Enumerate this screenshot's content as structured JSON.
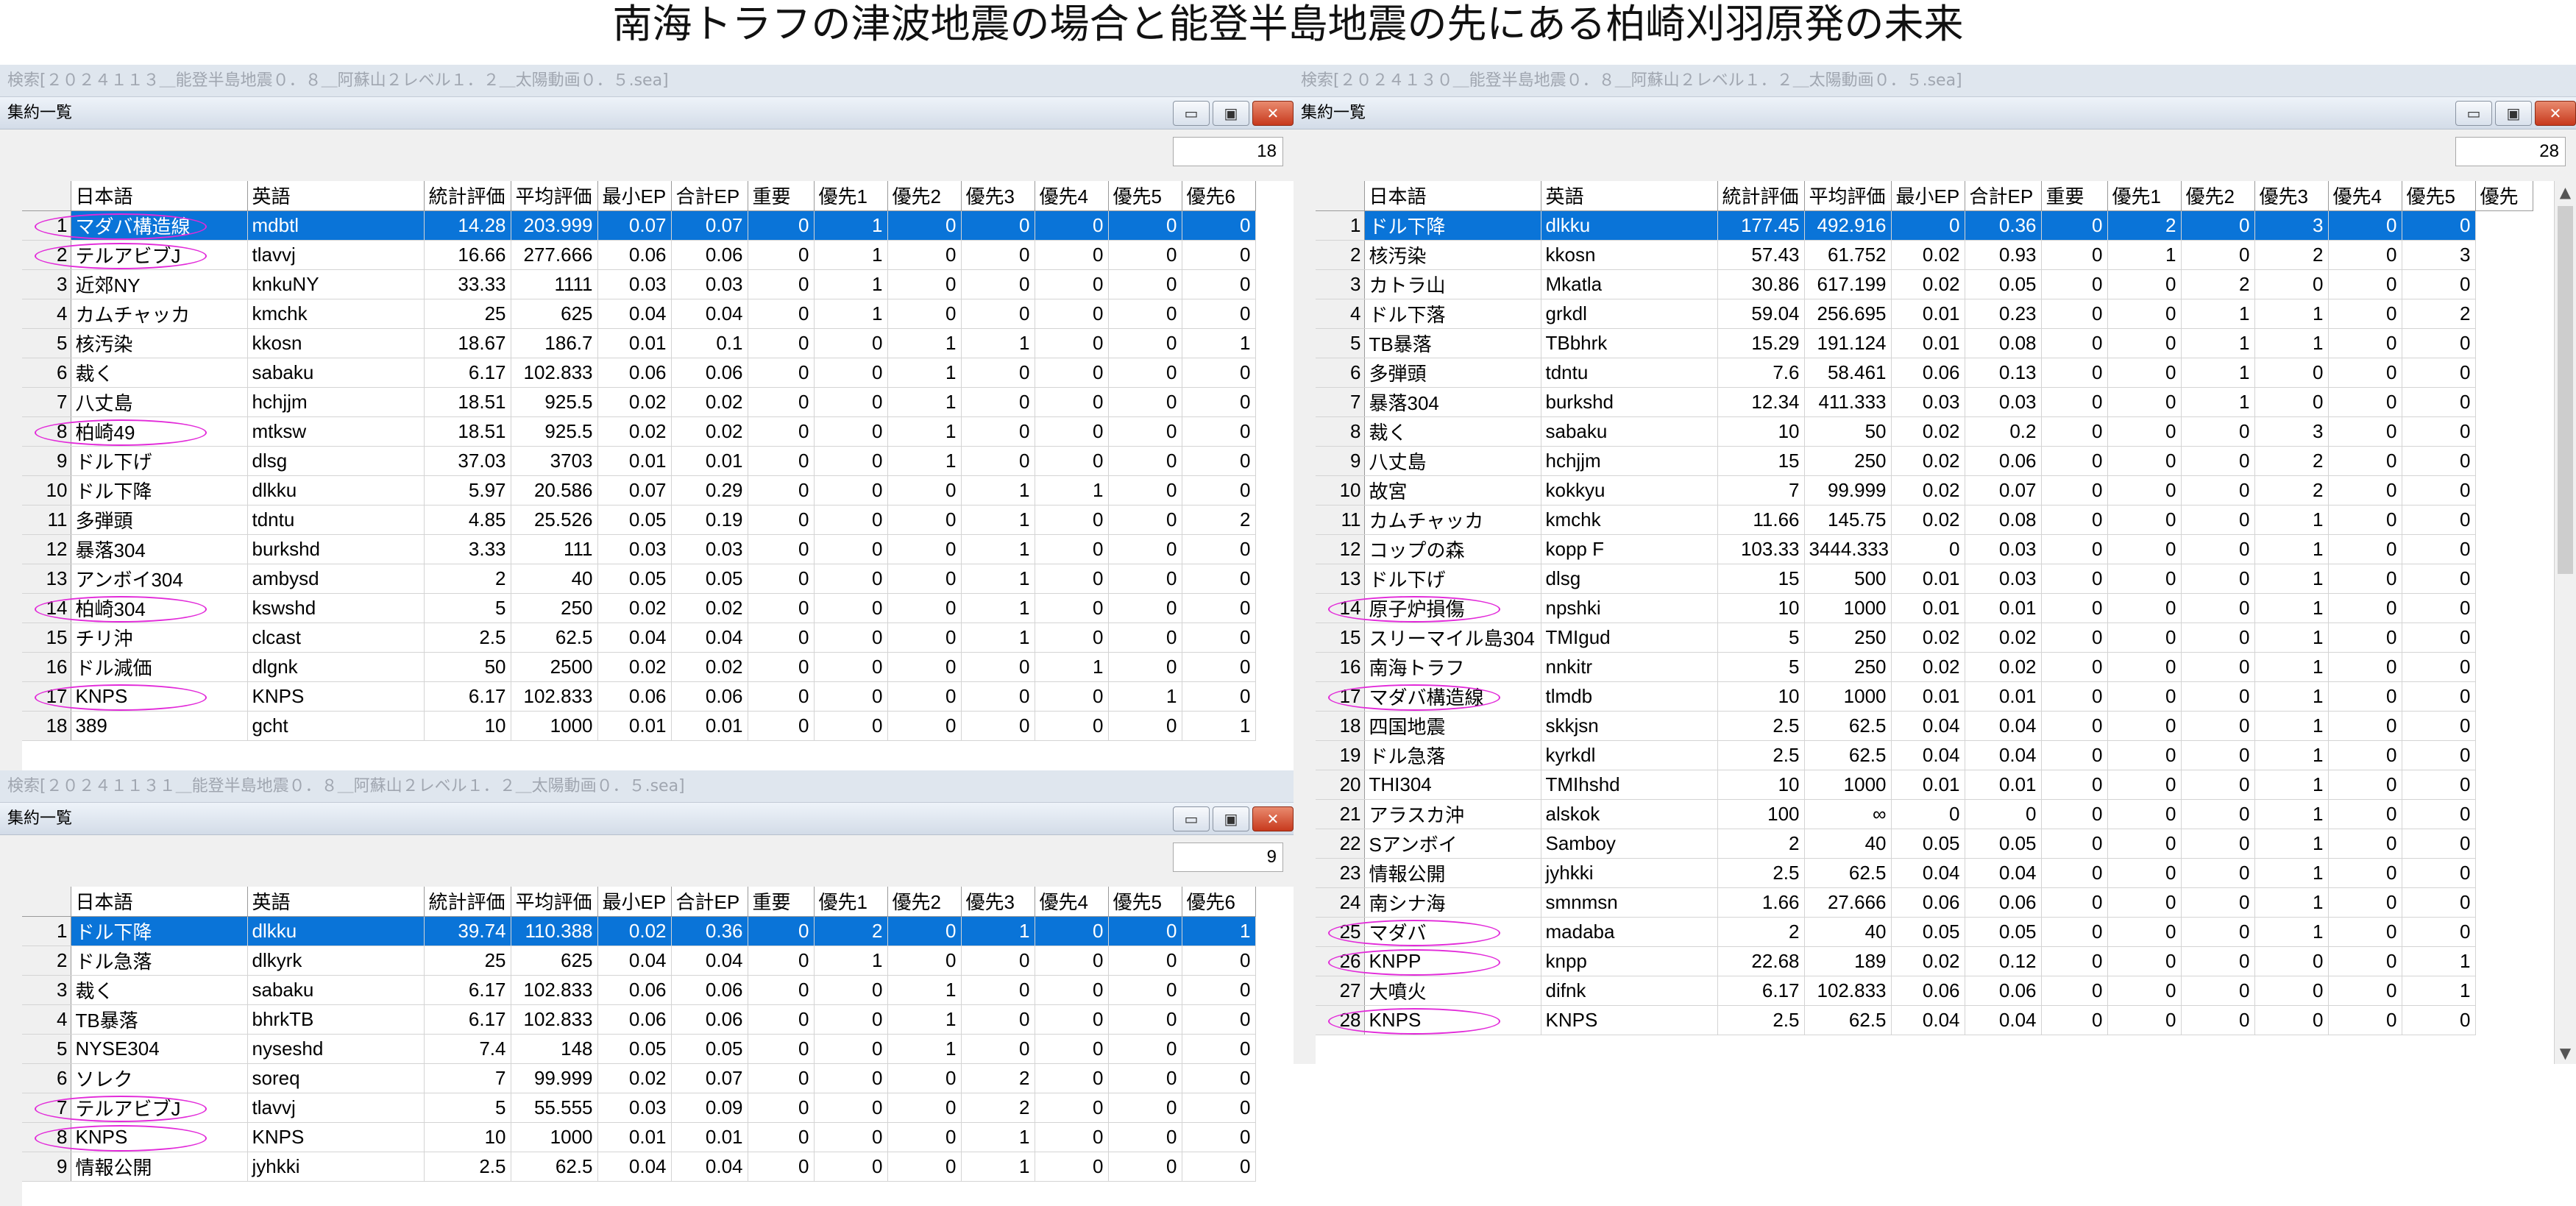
{
  "page": {
    "title": "南海トラフの津波地震の場合と能登半島地震の先にある柏崎刈羽原発の未来"
  },
  "colors": {
    "selected_row": "#0a74d8",
    "highlight_ellipse": "#e22ad9",
    "close_button": "#c7391d"
  },
  "columns": [
    "日本語",
    "英語",
    "統計評価",
    "平均評価",
    "最小EP",
    "合計EP",
    "重要",
    "優先1",
    "優先2",
    "優先3",
    "優先4",
    "優先5",
    "優先6"
  ],
  "columns_p3": [
    "日本語",
    "英語",
    "統計評価",
    "平均評価",
    "最小EP",
    "合計EP",
    "重要",
    "優先1",
    "優先2",
    "優先3",
    "優先4",
    "優先5",
    "優先"
  ],
  "panels": [
    {
      "search": "検索[２０２４１１３＿能登半島地震０．８＿阿蘇山２レベル１．２＿太陽動画０．５.sea]",
      "window_title": "集約一覧",
      "count": "18",
      "selected": 0,
      "highlighted": [
        0,
        1,
        7,
        13,
        16
      ],
      "rows": [
        [
          "1",
          "マダバ構造線",
          "mdbtl",
          "14.28",
          "203.999",
          "0.07",
          "0.07",
          "0",
          "1",
          "0",
          "0",
          "0",
          "0",
          "0"
        ],
        [
          "2",
          "テルアビブJ",
          "tlavvj",
          "16.66",
          "277.666",
          "0.06",
          "0.06",
          "0",
          "1",
          "0",
          "0",
          "0",
          "0",
          "0"
        ],
        [
          "3",
          "近郊NY",
          "knkuNY",
          "33.33",
          "1111",
          "0.03",
          "0.03",
          "0",
          "1",
          "0",
          "0",
          "0",
          "0",
          "0"
        ],
        [
          "4",
          "カムチャッカ",
          "kmchk",
          "25",
          "625",
          "0.04",
          "0.04",
          "0",
          "1",
          "0",
          "0",
          "0",
          "0",
          "0"
        ],
        [
          "5",
          "核汚染",
          "kkosn",
          "18.67",
          "186.7",
          "0.01",
          "0.1",
          "0",
          "0",
          "1",
          "1",
          "0",
          "0",
          "1"
        ],
        [
          "6",
          "裁く",
          "sabaku",
          "6.17",
          "102.833",
          "0.06",
          "0.06",
          "0",
          "0",
          "1",
          "0",
          "0",
          "0",
          "0"
        ],
        [
          "7",
          "八丈島",
          "hchjjm",
          "18.51",
          "925.5",
          "0.02",
          "0.02",
          "0",
          "0",
          "1",
          "0",
          "0",
          "0",
          "0"
        ],
        [
          "8",
          "柏崎49",
          "mtksw",
          "18.51",
          "925.5",
          "0.02",
          "0.02",
          "0",
          "0",
          "1",
          "0",
          "0",
          "0",
          "0"
        ],
        [
          "9",
          "ドル下げ",
          "dlsg",
          "37.03",
          "3703",
          "0.01",
          "0.01",
          "0",
          "0",
          "1",
          "0",
          "0",
          "0",
          "0"
        ],
        [
          "10",
          "ドル下降",
          "dlkku",
          "5.97",
          "20.586",
          "0.07",
          "0.29",
          "0",
          "0",
          "0",
          "1",
          "1",
          "0",
          "0"
        ],
        [
          "11",
          "多弾頭",
          "tdntu",
          "4.85",
          "25.526",
          "0.05",
          "0.19",
          "0",
          "0",
          "0",
          "1",
          "0",
          "0",
          "2"
        ],
        [
          "12",
          "暴落304",
          "burkshd",
          "3.33",
          "111",
          "0.03",
          "0.03",
          "0",
          "0",
          "0",
          "1",
          "0",
          "0",
          "0"
        ],
        [
          "13",
          "アンボイ304",
          "ambysd",
          "2",
          "40",
          "0.05",
          "0.05",
          "0",
          "0",
          "0",
          "1",
          "0",
          "0",
          "0"
        ],
        [
          "14",
          "柏崎304",
          "kswshd",
          "5",
          "250",
          "0.02",
          "0.02",
          "0",
          "0",
          "0",
          "1",
          "0",
          "0",
          "0"
        ],
        [
          "15",
          "チリ沖",
          "clcast",
          "2.5",
          "62.5",
          "0.04",
          "0.04",
          "0",
          "0",
          "0",
          "1",
          "0",
          "0",
          "0"
        ],
        [
          "16",
          "ドル減価",
          "dlgnk",
          "50",
          "2500",
          "0.02",
          "0.02",
          "0",
          "0",
          "0",
          "0",
          "1",
          "0",
          "0"
        ],
        [
          "17",
          "KNPS",
          "KNPS",
          "6.17",
          "102.833",
          "0.06",
          "0.06",
          "0",
          "0",
          "0",
          "0",
          "0",
          "1",
          "0"
        ],
        [
          "18",
          "389",
          "gcht",
          "10",
          "1000",
          "0.01",
          "0.01",
          "0",
          "0",
          "0",
          "0",
          "0",
          "0",
          "1"
        ]
      ]
    },
    {
      "search": "検索[２０２４１１３１＿能登半島地震０．８＿阿蘇山２レベル１．２＿太陽動画０．５.sea]",
      "window_title": "集約一覧",
      "count": "9",
      "selected": 0,
      "highlighted": [
        6,
        7
      ],
      "rows": [
        [
          "1",
          "ドル下降",
          "dlkku",
          "39.74",
          "110.388",
          "0.02",
          "0.36",
          "0",
          "2",
          "0",
          "1",
          "0",
          "0",
          "1"
        ],
        [
          "2",
          "ドル急落",
          "dlkyrk",
          "25",
          "625",
          "0.04",
          "0.04",
          "0",
          "1",
          "0",
          "0",
          "0",
          "0",
          "0"
        ],
        [
          "3",
          "裁く",
          "sabaku",
          "6.17",
          "102.833",
          "0.06",
          "0.06",
          "0",
          "0",
          "1",
          "0",
          "0",
          "0",
          "0"
        ],
        [
          "4",
          "TB暴落",
          "bhrkTB",
          "6.17",
          "102.833",
          "0.06",
          "0.06",
          "0",
          "0",
          "1",
          "0",
          "0",
          "0",
          "0"
        ],
        [
          "5",
          "NYSE304",
          "nyseshd",
          "7.4",
          "148",
          "0.05",
          "0.05",
          "0",
          "0",
          "1",
          "0",
          "0",
          "0",
          "0"
        ],
        [
          "6",
          "ソレク",
          "soreq",
          "7",
          "99.999",
          "0.02",
          "0.07",
          "0",
          "0",
          "0",
          "2",
          "0",
          "0",
          "0"
        ],
        [
          "7",
          "テルアビブJ",
          "tlavvj",
          "5",
          "55.555",
          "0.03",
          "0.09",
          "0",
          "0",
          "0",
          "2",
          "0",
          "0",
          "0"
        ],
        [
          "8",
          "KNPS",
          "KNPS",
          "10",
          "1000",
          "0.01",
          "0.01",
          "0",
          "0",
          "0",
          "1",
          "0",
          "0",
          "0"
        ],
        [
          "9",
          "情報公開",
          "jyhkki",
          "2.5",
          "62.5",
          "0.04",
          "0.04",
          "0",
          "0",
          "0",
          "1",
          "0",
          "0",
          "0"
        ]
      ]
    },
    {
      "search": "検索[２０２４１３０＿能登半島地震０．８＿阿蘇山２レベル１．２＿太陽動画０．５.sea]",
      "window_title": "集約一覧",
      "count": "28",
      "selected": 0,
      "highlighted": [
        13,
        16,
        24,
        25,
        27
      ],
      "rows": [
        [
          "1",
          "ドル下降",
          "dlkku",
          "177.45",
          "492.916",
          "0",
          "0.36",
          "0",
          "2",
          "0",
          "3",
          "0",
          "0"
        ],
        [
          "2",
          "核汚染",
          "kkosn",
          "57.43",
          "61.752",
          "0.02",
          "0.93",
          "0",
          "1",
          "0",
          "2",
          "0",
          "3"
        ],
        [
          "3",
          "カトラ山",
          "Mkatla",
          "30.86",
          "617.199",
          "0.02",
          "0.05",
          "0",
          "0",
          "2",
          "0",
          "0",
          "0"
        ],
        [
          "4",
          "ドル下落",
          "grkdl",
          "59.04",
          "256.695",
          "0.01",
          "0.23",
          "0",
          "0",
          "1",
          "1",
          "0",
          "2"
        ],
        [
          "5",
          "TB暴落",
          "TBbhrk",
          "15.29",
          "191.124",
          "0.01",
          "0.08",
          "0",
          "0",
          "1",
          "1",
          "0",
          "0"
        ],
        [
          "6",
          "多弾頭",
          "tdntu",
          "7.6",
          "58.461",
          "0.06",
          "0.13",
          "0",
          "0",
          "1",
          "0",
          "0",
          "0"
        ],
        [
          "7",
          "暴落304",
          "burkshd",
          "12.34",
          "411.333",
          "0.03",
          "0.03",
          "0",
          "0",
          "1",
          "0",
          "0",
          "0"
        ],
        [
          "8",
          "裁く",
          "sabaku",
          "10",
          "50",
          "0.02",
          "0.2",
          "0",
          "0",
          "0",
          "3",
          "0",
          "0"
        ],
        [
          "9",
          "八丈島",
          "hchjjm",
          "15",
          "250",
          "0.02",
          "0.06",
          "0",
          "0",
          "0",
          "2",
          "0",
          "0"
        ],
        [
          "10",
          "故宮",
          "kokkyu",
          "7",
          "99.999",
          "0.02",
          "0.07",
          "0",
          "0",
          "0",
          "2",
          "0",
          "0"
        ],
        [
          "11",
          "カムチャッカ",
          "kmchk",
          "11.66",
          "145.75",
          "0.02",
          "0.08",
          "0",
          "0",
          "0",
          "1",
          "0",
          "0"
        ],
        [
          "12",
          "コップの森",
          "kopp F",
          "103.33",
          "3444.333",
          "0",
          "0.03",
          "0",
          "0",
          "0",
          "1",
          "0",
          "0"
        ],
        [
          "13",
          "ドル下げ",
          "dlsg",
          "15",
          "500",
          "0.01",
          "0.03",
          "0",
          "0",
          "0",
          "1",
          "0",
          "0"
        ],
        [
          "14",
          "原子炉損傷",
          "npshki",
          "10",
          "1000",
          "0.01",
          "0.01",
          "0",
          "0",
          "0",
          "1",
          "0",
          "0"
        ],
        [
          "15",
          "スリーマイル島304",
          "TMIgud",
          "5",
          "250",
          "0.02",
          "0.02",
          "0",
          "0",
          "0",
          "1",
          "0",
          "0"
        ],
        [
          "16",
          "南海トラフ",
          "nnkitr",
          "5",
          "250",
          "0.02",
          "0.02",
          "0",
          "0",
          "0",
          "1",
          "0",
          "0"
        ],
        [
          "17",
          "マダバ構造線",
          "tlmdb",
          "10",
          "1000",
          "0.01",
          "0.01",
          "0",
          "0",
          "0",
          "1",
          "0",
          "0"
        ],
        [
          "18",
          "四国地震",
          "skkjsn",
          "2.5",
          "62.5",
          "0.04",
          "0.04",
          "0",
          "0",
          "0",
          "1",
          "0",
          "0"
        ],
        [
          "19",
          "ドル急落",
          "kyrkdl",
          "2.5",
          "62.5",
          "0.04",
          "0.04",
          "0",
          "0",
          "0",
          "1",
          "0",
          "0"
        ],
        [
          "20",
          "THI304",
          "TMIhshd",
          "10",
          "1000",
          "0.01",
          "0.01",
          "0",
          "0",
          "0",
          "1",
          "0",
          "0"
        ],
        [
          "21",
          "アラスカ沖",
          "alskok",
          "100",
          "∞",
          "0",
          "0",
          "0",
          "0",
          "0",
          "1",
          "0",
          "0"
        ],
        [
          "22",
          "Sアンボイ",
          "Samboy",
          "2",
          "40",
          "0.05",
          "0.05",
          "0",
          "0",
          "0",
          "1",
          "0",
          "0"
        ],
        [
          "23",
          "情報公開",
          "jyhkki",
          "2.5",
          "62.5",
          "0.04",
          "0.04",
          "0",
          "0",
          "0",
          "1",
          "0",
          "0"
        ],
        [
          "24",
          "南シナ海",
          "smnmsn",
          "1.66",
          "27.666",
          "0.06",
          "0.06",
          "0",
          "0",
          "0",
          "1",
          "0",
          "0"
        ],
        [
          "25",
          "マダバ",
          "madaba",
          "2",
          "40",
          "0.05",
          "0.05",
          "0",
          "0",
          "0",
          "1",
          "0",
          "0"
        ],
        [
          "26",
          "KNPP",
          "knpp",
          "22.68",
          "189",
          "0.02",
          "0.12",
          "0",
          "0",
          "0",
          "0",
          "0",
          "1"
        ],
        [
          "27",
          "大噴火",
          "difnk",
          "6.17",
          "102.833",
          "0.06",
          "0.06",
          "0",
          "0",
          "0",
          "0",
          "0",
          "1"
        ],
        [
          "28",
          "KNPS",
          "KNPS",
          "2.5",
          "62.5",
          "0.04",
          "0.04",
          "0",
          "0",
          "0",
          "0",
          "0",
          "0"
        ]
      ]
    }
  ],
  "scrollbar": {
    "up": "▲",
    "down": "▼"
  },
  "window_buttons": {
    "minimize": "▭",
    "restore": "▣",
    "close": "✕"
  }
}
